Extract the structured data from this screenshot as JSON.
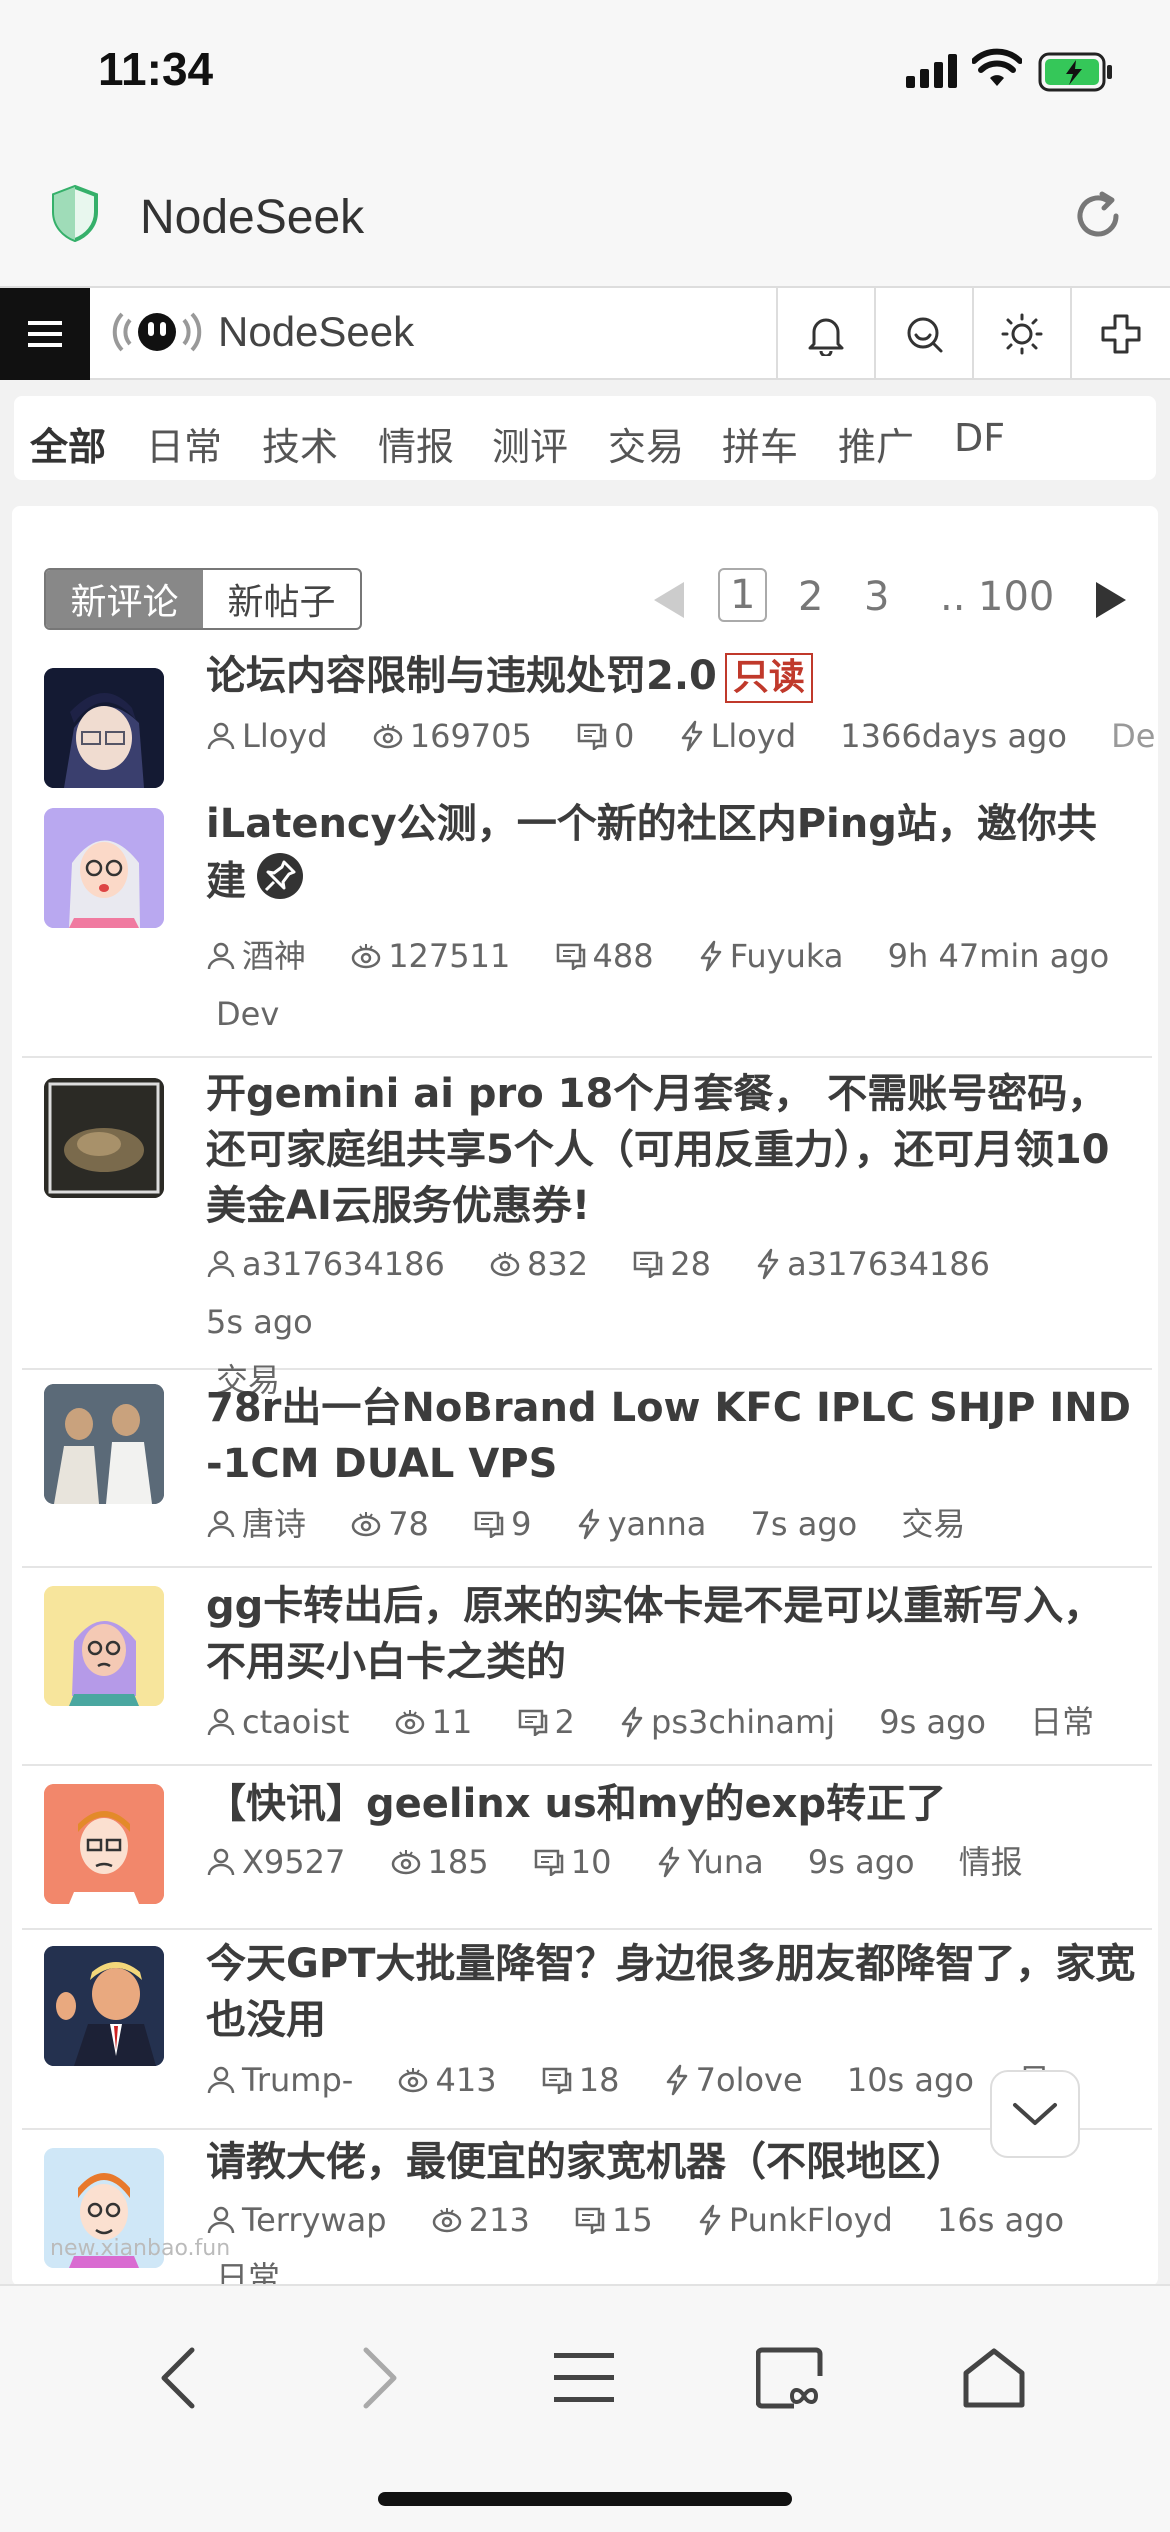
{
  "status_bar": {
    "time": "11:34"
  },
  "browser": {
    "site_name": "NodeSeek"
  },
  "site_header": {
    "logo_text": "NodeSeek"
  },
  "categories": [
    "全部",
    "日常",
    "技术",
    "情报",
    "测评",
    "交易",
    "拼车",
    "推广",
    "DF"
  ],
  "sort_tabs": [
    "新评论",
    "新帖子"
  ],
  "pagination": {
    "pages": [
      "1",
      "2",
      "3"
    ],
    "ellipsis": "..",
    "last": "100",
    "current": "1"
  },
  "posts": [
    {
      "title": "论坛内容限制与违规处罚2.0",
      "badge": "只读",
      "author": "Lloyd",
      "views": "169705",
      "comments": "0",
      "last_reply": "Lloyd",
      "time": "1366days ago",
      "category": "De"
    },
    {
      "title": "iLatency公测，一个新的社区内Ping站，邀你共建",
      "author": "酒神",
      "views": "127511",
      "comments": "488",
      "last_reply": "Fuyuka",
      "time": "9h 47min ago",
      "category": "Dev"
    },
    {
      "title": "开gemini ai pro 18个月套餐， 不需账号密码，还可家庭组共享5个人（可用反重力），还可月领10美金AI云服务优惠券!",
      "author": "a317634186",
      "views": "832",
      "comments": "28",
      "last_reply": "a317634186",
      "time": "5s ago",
      "category": "交易"
    },
    {
      "title": "78r出一台NoBrand Low KFC IPLC SHJP IND -1CM DUAL VPS",
      "author": "唐诗",
      "views": "78",
      "comments": "9",
      "last_reply": "yanna",
      "time": "7s ago",
      "category": "交易"
    },
    {
      "title": "gg卡转出后，原来的实体卡是不是可以重新写入，不用买小白卡之类的",
      "author": "ctaoist",
      "views": "11",
      "comments": "2",
      "last_reply": "ps3chinamj",
      "time": "9s ago",
      "category": "日常"
    },
    {
      "title": "【快讯】geelinx us和my的exp转正了",
      "author": "X9527",
      "views": "185",
      "comments": "10",
      "last_reply": "Yuna",
      "time": "9s ago",
      "category": "情报"
    },
    {
      "title": "今天GPT大批量降智？身边很多朋友都降智了，家宽也没用",
      "author": "Trump-",
      "views": "413",
      "comments": "18",
      "last_reply": "7olove",
      "time": "10s ago",
      "category": "日"
    },
    {
      "title": "请教大佬，最便宜的家宽机器（不限地区）",
      "author": "Terrywap",
      "views": "213",
      "comments": "15",
      "last_reply": "PunkFloyd",
      "time": "16s ago",
      "category": "日常"
    }
  ],
  "watermark": "new.xianbao.fun",
  "colors": {
    "accent_active_tab": "#888888",
    "readonly_red": "#c0392b",
    "menu_bg": "#111111"
  }
}
